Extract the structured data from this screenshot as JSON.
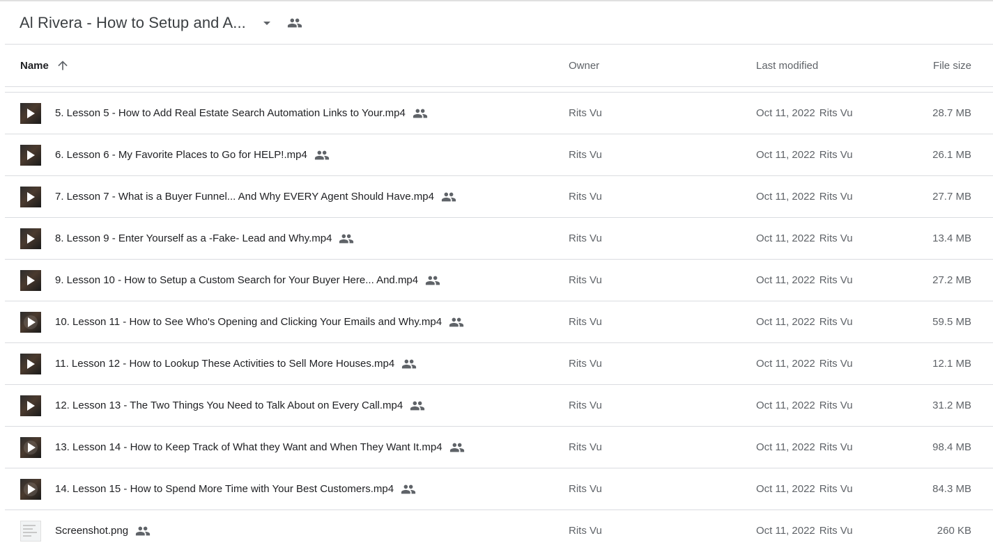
{
  "header": {
    "folder_title": "Al Rivera - How to Setup and A...",
    "caret_icon": "caret-down-icon",
    "shared_icon": "people-icon"
  },
  "columns": {
    "name": "Name",
    "sort_icon": "arrow-up-icon",
    "owner": "Owner",
    "last_modified": "Last modified",
    "file_size": "File size"
  },
  "files": [
    {
      "name": "5. Lesson 5 - How to Add Real Estate Search Automation Links to Your.mp4",
      "owner": "Rits Vu",
      "date": "Oct 11, 2022",
      "modified_by": "Rits Vu",
      "size": "28.7 MB",
      "type": "video"
    },
    {
      "name": "6. Lesson 6 - My Favorite Places to Go for HELP!.mp4",
      "owner": "Rits Vu",
      "date": "Oct 11, 2022",
      "modified_by": "Rits Vu",
      "size": "26.1 MB",
      "type": "video"
    },
    {
      "name": "7. Lesson 7 - What is a Buyer Funnel... And Why EVERY Agent Should Have.mp4",
      "owner": "Rits Vu",
      "date": "Oct 11, 2022",
      "modified_by": "Rits Vu",
      "size": "27.7 MB",
      "type": "video"
    },
    {
      "name": "8. Lesson 9 - Enter Yourself as a -Fake- Lead and Why.mp4",
      "owner": "Rits Vu",
      "date": "Oct 11, 2022",
      "modified_by": "Rits Vu",
      "size": "13.4 MB",
      "type": "video"
    },
    {
      "name": "9. Lesson 10 - How to Setup a Custom Search for Your Buyer Here... And.mp4",
      "owner": "Rits Vu",
      "date": "Oct 11, 2022",
      "modified_by": "Rits Vu",
      "size": "27.2 MB",
      "type": "video"
    },
    {
      "name": "10. Lesson 11 - How to See Who's Opening and Clicking Your Emails and Why.mp4",
      "owner": "Rits Vu",
      "date": "Oct 11, 2022",
      "modified_by": "Rits Vu",
      "size": "59.5 MB",
      "type": "video-round"
    },
    {
      "name": "11. Lesson 12 - How to Lookup These Activities to Sell More Houses.mp4",
      "owner": "Rits Vu",
      "date": "Oct 11, 2022",
      "modified_by": "Rits Vu",
      "size": "12.1 MB",
      "type": "video"
    },
    {
      "name": "12. Lesson 13 - The Two Things You Need to Talk About on Every Call.mp4",
      "owner": "Rits Vu",
      "date": "Oct 11, 2022",
      "modified_by": "Rits Vu",
      "size": "31.2 MB",
      "type": "video"
    },
    {
      "name": "13. Lesson 14 - How to Keep Track of What they Want and When They Want It.mp4",
      "owner": "Rits Vu",
      "date": "Oct 11, 2022",
      "modified_by": "Rits Vu",
      "size": "98.4 MB",
      "type": "video-round"
    },
    {
      "name": "14. Lesson 15 - How to Spend More Time with Your Best Customers.mp4",
      "owner": "Rits Vu",
      "date": "Oct 11, 2022",
      "modified_by": "Rits Vu",
      "size": "84.3 MB",
      "type": "video-round"
    },
    {
      "name": "Screenshot.png",
      "owner": "Rits Vu",
      "date": "Oct 11, 2022",
      "modified_by": "Rits Vu",
      "size": "260 KB",
      "type": "image"
    }
  ],
  "colors": {
    "text_primary": "#202124",
    "text_secondary": "#5f6368",
    "divider": "#dadce0",
    "icon": "#5f6368"
  }
}
